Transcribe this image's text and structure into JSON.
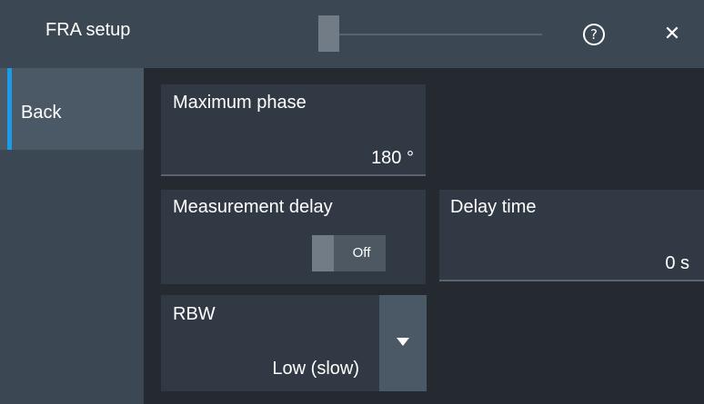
{
  "window": {
    "title": "FRA setup",
    "help_icon": "help-icon",
    "help_glyph": "?",
    "close_icon": "close-icon",
    "close_glyph": "✕"
  },
  "sidebar": {
    "items": [
      {
        "label": "Back",
        "selected": true
      }
    ]
  },
  "settings": {
    "max_phase": {
      "label": "Maximum phase",
      "value": "180 °"
    },
    "measurement_delay": {
      "label": "Measurement delay",
      "state": "Off"
    },
    "delay_time": {
      "label": "Delay time",
      "value": "0 s"
    },
    "rbw": {
      "label": "RBW",
      "value": "Low (slow)"
    }
  },
  "colors": {
    "background": "#252a30",
    "titlebar": "#3b4753",
    "panel": "#313a44",
    "selected": "#4b5966",
    "accent": "#1e9be6"
  }
}
